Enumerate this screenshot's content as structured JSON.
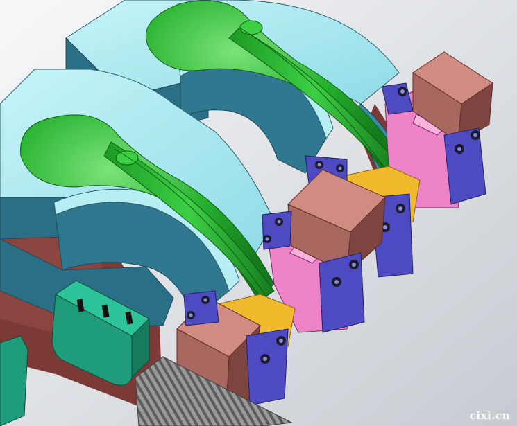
{
  "render": {
    "title": "",
    "watermark": "cixi.cn",
    "colors": {
      "background_light": "#f2f3f5",
      "background_dark": "#c8ccd2",
      "mold_top": "#a9e8f0",
      "mold_side": "#2b6f86",
      "core_green": "#21b32b",
      "core_green_dark": "#157a1d",
      "base_plate": "#7b3a36",
      "lifter_block": "#b57a70",
      "pink_plate": "#ee83c8",
      "yellow_block": "#f1b92c",
      "blue_clamp": "#4d4ac2",
      "teal_block": "#1f9c7c",
      "rack_grey": "#8c8c8c"
    }
  }
}
